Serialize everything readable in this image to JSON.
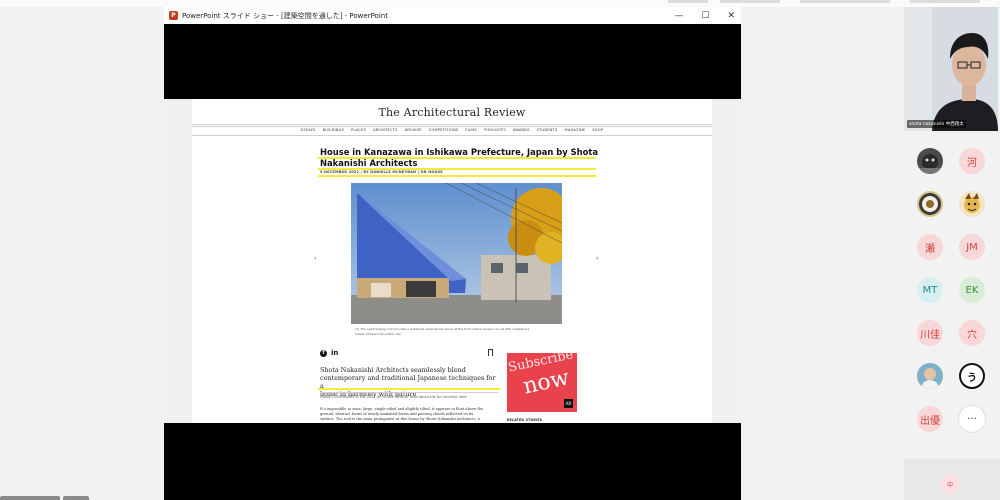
{
  "window": {
    "title": "PowerPoint スライド ショー - [建築空間を通した] - PowerPoint",
    "minimize": "—",
    "maximize": "☐",
    "close": "✕"
  },
  "site": {
    "logo": "The Architectural Review",
    "nav": [
      "ESSAYS",
      "BUILDINGS",
      "PLACES",
      "ARCHITECTS",
      "ARCHIVE",
      "COMPETITIONS",
      "FILMS",
      "THOUGHTS",
      "AWARDS",
      "STUDENTS",
      "MAGAZINE",
      "SHOP"
    ]
  },
  "article": {
    "headline_line1": "House in Kanazawa in Ishikawa Prefecture, Japan by Shota",
    "headline_line2": "Nakanishi Architects",
    "byline": "9 DECEMBER 2021  |  BY DANIELLE MCNEYBAN  |  ON HOUSE",
    "carousel_prev": "‹",
    "carousel_next": "›",
    "caption_line1": "(1) The overhanging roof provides a sheltered veranda-like space at the front where owners can sit with neighbours",
    "caption_line2": "Credit: Shintaro Kinoshita / Aki",
    "share_fb": "f",
    "share_in": "in",
    "dek_line1": "Shota Nakanishi Architects seamlessly blend",
    "dek_line2": "contemporary and traditional Japanese techniques for a",
    "dek_line3": "home in harmony with nature",
    "intro": "Highly Commended in the 2021 AR House awards: read about the full shortlist here",
    "body_line1": "It’s impossible to miss: large, single-sided and slightly tilted, it appears to float above the",
    "body_line2": "ground, abstract forms of neatly animated forms and passing clouds reflected on its",
    "body_line3": "surface. The roof is the main protagonist at this house by Shota Nakanishi Architects, a"
  },
  "ad": {
    "subscribe": "Subscribe",
    "now": "now",
    "logo": "AR"
  },
  "related": "RELATED STORIES",
  "participants": {
    "video_name": "shota nakanishi 中西翔太",
    "tiles": [
      {
        "label": "",
        "icon": "animal-photo-icon",
        "color": "#4b4b4b"
      },
      {
        "label": "河",
        "icon": "",
        "color": "#f7d7d7"
      },
      {
        "label": "",
        "icon": "emblem-photo-icon",
        "color": "#d8c48a"
      },
      {
        "label": "",
        "icon": "character-photo-icon",
        "color": "#f3e4c4"
      },
      {
        "label": "瀬",
        "icon": "",
        "color": "#f7d7d7"
      },
      {
        "label": "JM",
        "icon": "",
        "color": "#f7d7d7"
      },
      {
        "label": "MT",
        "icon": "",
        "color": "#d7efef"
      },
      {
        "label": "EK",
        "icon": "",
        "color": "#d9ecd9"
      },
      {
        "label": "川佳",
        "icon": "",
        "color": "#f7d7d7"
      },
      {
        "label": "穴",
        "icon": "",
        "color": "#f7d7d7"
      },
      {
        "label": "",
        "icon": "person-photo-icon",
        "color": "#cfe0e6"
      },
      {
        "label": "う",
        "icon": "",
        "color": "#ffffff"
      },
      {
        "label": "出優",
        "icon": "",
        "color": "#f7d7d7"
      },
      {
        "label": "···",
        "icon": "more-icon",
        "color": "#ffffff"
      }
    ],
    "panel_button": "中"
  },
  "colors": {
    "highlight": "#f3ec34",
    "ad_red": "#e8434d",
    "ppt_orange": "#c43e1c"
  }
}
